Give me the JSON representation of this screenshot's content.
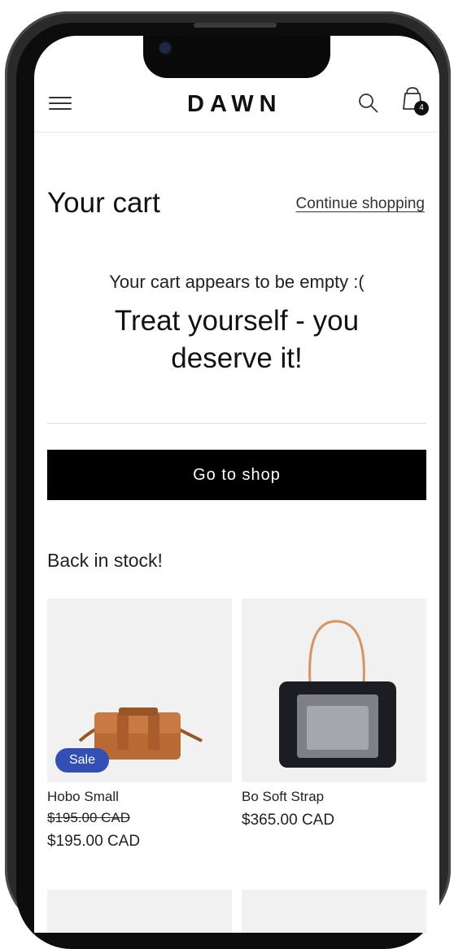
{
  "store": {
    "logo": "DAWN",
    "cart_count": "4"
  },
  "cart": {
    "title": "Your cart",
    "continue_label": "Continue shopping",
    "empty_message": "Your cart appears to be empty :(",
    "empty_tagline": "Treat yourself - you deserve it!",
    "go_to_shop_label": "Go to shop"
  },
  "section": {
    "title": "Back in stock!"
  },
  "products": [
    {
      "name": "Hobo Small",
      "badge": "Sale",
      "compare_price": "$195.00 CAD",
      "price": "$195.00 CAD",
      "bag_color": "#b86a35"
    },
    {
      "name": "Bo Soft Strap",
      "price": "$365.00 CAD",
      "bag_color": "#1c1d22"
    }
  ],
  "icons": [
    "hamburger-icon",
    "search-icon",
    "shopping-bag-icon"
  ]
}
